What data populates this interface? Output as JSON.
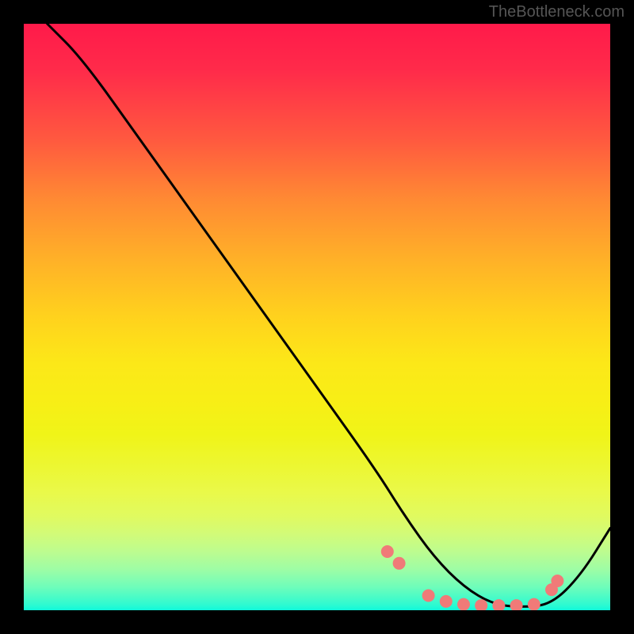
{
  "watermark": "TheBottleneck.com",
  "chart_data": {
    "type": "line",
    "title": "",
    "xlabel": "",
    "ylabel": "",
    "xlim": [
      0,
      100
    ],
    "ylim": [
      0,
      100
    ],
    "series": [
      {
        "name": "curve",
        "color": "#000000",
        "x": [
          4,
          10,
          20,
          30,
          40,
          50,
          60,
          65,
          70,
          75,
          80,
          85,
          90,
          95,
          100
        ],
        "y": [
          100,
          94,
          80,
          66,
          52,
          38,
          24,
          16,
          9,
          4,
          1,
          0.5,
          1,
          6,
          14
        ]
      }
    ],
    "markers": {
      "name": "dots",
      "color": "#f07a78",
      "radius": 8,
      "x": [
        62,
        64,
        69,
        72,
        75,
        78,
        81,
        84,
        87,
        90,
        91
      ],
      "y": [
        10,
        8,
        2.5,
        1.5,
        1,
        0.8,
        0.8,
        0.8,
        1,
        3.5,
        5
      ]
    },
    "background_gradient": {
      "type": "vertical",
      "stops": [
        {
          "pos": 0,
          "color": "#ff1a4a"
        },
        {
          "pos": 50,
          "color": "#ffd21d"
        },
        {
          "pos": 80,
          "color": "#e9f94a"
        },
        {
          "pos": 100,
          "color": "#10f9da"
        }
      ]
    }
  }
}
